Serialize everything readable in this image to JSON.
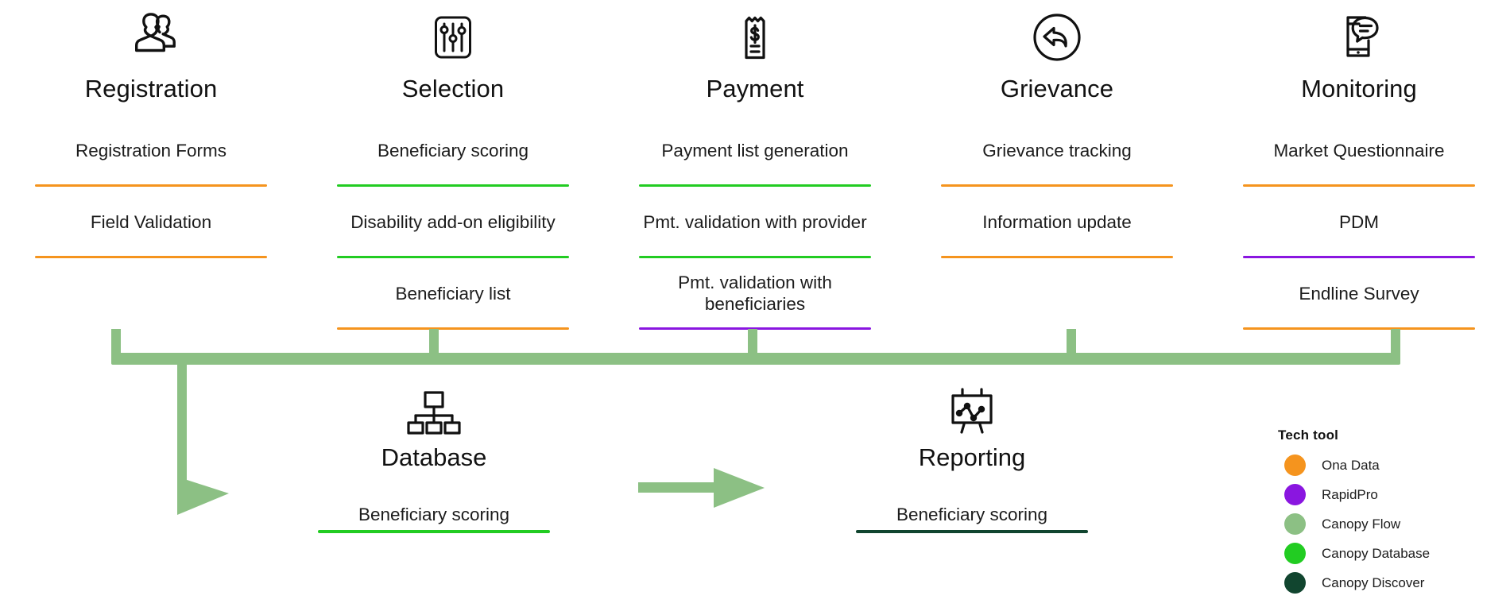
{
  "colors": {
    "ona_data": "#F5941E",
    "rapidpro": "#8A16E0",
    "canopy_flow": "#8CC084",
    "canopy_database": "#22CC22",
    "canopy_discover": "#11452F",
    "text": "#1c1c1c"
  },
  "phases": [
    {
      "id": "registration",
      "title": "Registration",
      "icon": "users-icon",
      "steps": [
        {
          "label": "Registration Forms",
          "tool": "ona_data"
        },
        {
          "label": "Field Validation",
          "tool": "ona_data"
        },
        {
          "label": "",
          "tool": ""
        }
      ]
    },
    {
      "id": "selection",
      "title": "Selection",
      "icon": "sliders-icon",
      "steps": [
        {
          "label": "Beneficiary scoring",
          "tool": "canopy_database"
        },
        {
          "label": "Disability add-on eligibility",
          "tool": "canopy_database"
        },
        {
          "label": "Beneficiary list",
          "tool": "ona_data"
        }
      ]
    },
    {
      "id": "payment",
      "title": "Payment",
      "icon": "receipt-dollar-icon",
      "steps": [
        {
          "label": "Payment list generation",
          "tool": "canopy_database"
        },
        {
          "label": "Pmt. validation with provider",
          "tool": "canopy_database"
        },
        {
          "label": "Pmt. validation with beneficiaries",
          "tool": "rapidpro"
        }
      ]
    },
    {
      "id": "grievance",
      "title": "Grievance",
      "icon": "reply-circle-icon",
      "steps": [
        {
          "label": "Grievance tracking",
          "tool": "ona_data"
        },
        {
          "label": "Information update",
          "tool": "ona_data"
        },
        {
          "label": "",
          "tool": ""
        }
      ]
    },
    {
      "id": "monitoring",
      "title": "Monitoring",
      "icon": "mobile-chat-icon",
      "steps": [
        {
          "label": "Market Questionnaire",
          "tool": "ona_data"
        },
        {
          "label": "PDM",
          "tool": "rapidpro"
        },
        {
          "label": "Endline Survey",
          "tool": "ona_data"
        }
      ]
    }
  ],
  "bottom_nodes": [
    {
      "id": "database",
      "title": "Database",
      "icon": "org-chart-icon",
      "step": {
        "label": "Beneficiary scoring",
        "tool": "canopy_database"
      }
    },
    {
      "id": "reporting",
      "title": "Reporting",
      "icon": "chart-board-icon",
      "step": {
        "label": "Beneficiary scoring",
        "tool": "canopy_discover"
      }
    }
  ],
  "legend": {
    "title": "Tech tool",
    "items": [
      {
        "label": "Ona Data",
        "color": "#F5941E"
      },
      {
        "label": "RapidPro",
        "color": "#8A16E0"
      },
      {
        "label": "Canopy Flow",
        "color": "#8CC084"
      },
      {
        "label": "Canopy Database",
        "color": "#22CC22"
      },
      {
        "label": "Canopy Discover",
        "color": "#11452F"
      }
    ]
  }
}
